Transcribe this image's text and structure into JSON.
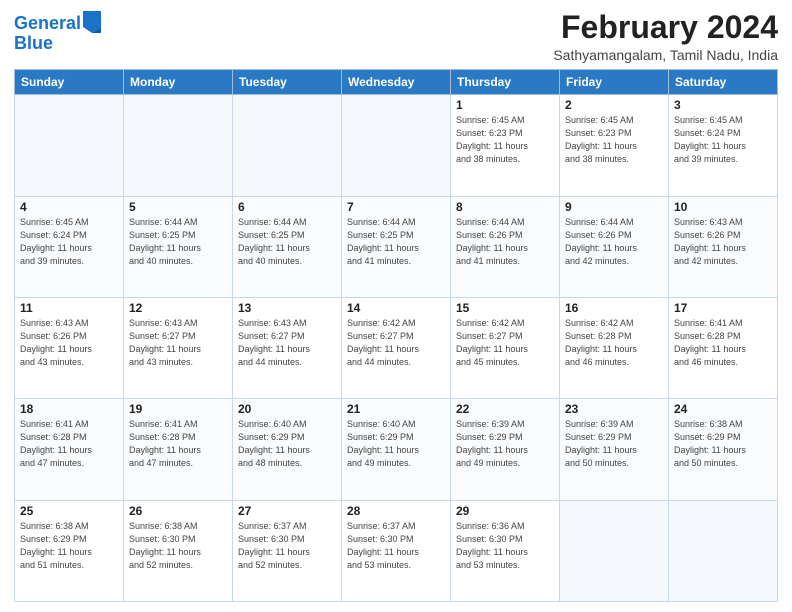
{
  "logo": {
    "line1": "General",
    "line2": "Blue"
  },
  "title": "February 2024",
  "subtitle": "Sathyamangalam, Tamil Nadu, India",
  "days_of_week": [
    "Sunday",
    "Monday",
    "Tuesday",
    "Wednesday",
    "Thursday",
    "Friday",
    "Saturday"
  ],
  "weeks": [
    [
      {
        "day": "",
        "info": ""
      },
      {
        "day": "",
        "info": ""
      },
      {
        "day": "",
        "info": ""
      },
      {
        "day": "",
        "info": ""
      },
      {
        "day": "1",
        "info": "Sunrise: 6:45 AM\nSunset: 6:23 PM\nDaylight: 11 hours\nand 38 minutes."
      },
      {
        "day": "2",
        "info": "Sunrise: 6:45 AM\nSunset: 6:23 PM\nDaylight: 11 hours\nand 38 minutes."
      },
      {
        "day": "3",
        "info": "Sunrise: 6:45 AM\nSunset: 6:24 PM\nDaylight: 11 hours\nand 39 minutes."
      }
    ],
    [
      {
        "day": "4",
        "info": "Sunrise: 6:45 AM\nSunset: 6:24 PM\nDaylight: 11 hours\nand 39 minutes."
      },
      {
        "day": "5",
        "info": "Sunrise: 6:44 AM\nSunset: 6:25 PM\nDaylight: 11 hours\nand 40 minutes."
      },
      {
        "day": "6",
        "info": "Sunrise: 6:44 AM\nSunset: 6:25 PM\nDaylight: 11 hours\nand 40 minutes."
      },
      {
        "day": "7",
        "info": "Sunrise: 6:44 AM\nSunset: 6:25 PM\nDaylight: 11 hours\nand 41 minutes."
      },
      {
        "day": "8",
        "info": "Sunrise: 6:44 AM\nSunset: 6:26 PM\nDaylight: 11 hours\nand 41 minutes."
      },
      {
        "day": "9",
        "info": "Sunrise: 6:44 AM\nSunset: 6:26 PM\nDaylight: 11 hours\nand 42 minutes."
      },
      {
        "day": "10",
        "info": "Sunrise: 6:43 AM\nSunset: 6:26 PM\nDaylight: 11 hours\nand 42 minutes."
      }
    ],
    [
      {
        "day": "11",
        "info": "Sunrise: 6:43 AM\nSunset: 6:26 PM\nDaylight: 11 hours\nand 43 minutes."
      },
      {
        "day": "12",
        "info": "Sunrise: 6:43 AM\nSunset: 6:27 PM\nDaylight: 11 hours\nand 43 minutes."
      },
      {
        "day": "13",
        "info": "Sunrise: 6:43 AM\nSunset: 6:27 PM\nDaylight: 11 hours\nand 44 minutes."
      },
      {
        "day": "14",
        "info": "Sunrise: 6:42 AM\nSunset: 6:27 PM\nDaylight: 11 hours\nand 44 minutes."
      },
      {
        "day": "15",
        "info": "Sunrise: 6:42 AM\nSunset: 6:27 PM\nDaylight: 11 hours\nand 45 minutes."
      },
      {
        "day": "16",
        "info": "Sunrise: 6:42 AM\nSunset: 6:28 PM\nDaylight: 11 hours\nand 46 minutes."
      },
      {
        "day": "17",
        "info": "Sunrise: 6:41 AM\nSunset: 6:28 PM\nDaylight: 11 hours\nand 46 minutes."
      }
    ],
    [
      {
        "day": "18",
        "info": "Sunrise: 6:41 AM\nSunset: 6:28 PM\nDaylight: 11 hours\nand 47 minutes."
      },
      {
        "day": "19",
        "info": "Sunrise: 6:41 AM\nSunset: 6:28 PM\nDaylight: 11 hours\nand 47 minutes."
      },
      {
        "day": "20",
        "info": "Sunrise: 6:40 AM\nSunset: 6:29 PM\nDaylight: 11 hours\nand 48 minutes."
      },
      {
        "day": "21",
        "info": "Sunrise: 6:40 AM\nSunset: 6:29 PM\nDaylight: 11 hours\nand 49 minutes."
      },
      {
        "day": "22",
        "info": "Sunrise: 6:39 AM\nSunset: 6:29 PM\nDaylight: 11 hours\nand 49 minutes."
      },
      {
        "day": "23",
        "info": "Sunrise: 6:39 AM\nSunset: 6:29 PM\nDaylight: 11 hours\nand 50 minutes."
      },
      {
        "day": "24",
        "info": "Sunrise: 6:38 AM\nSunset: 6:29 PM\nDaylight: 11 hours\nand 50 minutes."
      }
    ],
    [
      {
        "day": "25",
        "info": "Sunrise: 6:38 AM\nSunset: 6:29 PM\nDaylight: 11 hours\nand 51 minutes."
      },
      {
        "day": "26",
        "info": "Sunrise: 6:38 AM\nSunset: 6:30 PM\nDaylight: 11 hours\nand 52 minutes."
      },
      {
        "day": "27",
        "info": "Sunrise: 6:37 AM\nSunset: 6:30 PM\nDaylight: 11 hours\nand 52 minutes."
      },
      {
        "day": "28",
        "info": "Sunrise: 6:37 AM\nSunset: 6:30 PM\nDaylight: 11 hours\nand 53 minutes."
      },
      {
        "day": "29",
        "info": "Sunrise: 6:36 AM\nSunset: 6:30 PM\nDaylight: 11 hours\nand 53 minutes."
      },
      {
        "day": "",
        "info": ""
      },
      {
        "day": "",
        "info": ""
      }
    ]
  ]
}
